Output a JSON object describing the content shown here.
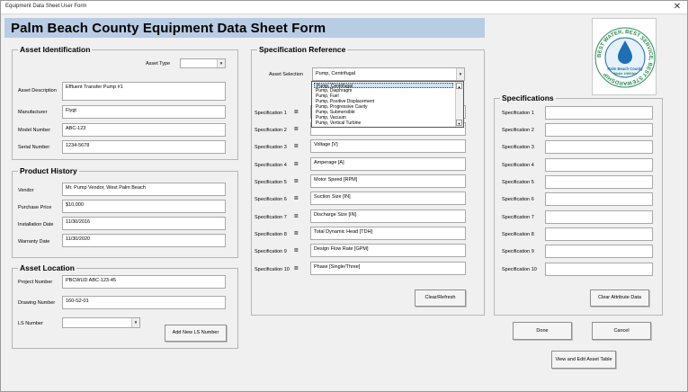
{
  "window": {
    "title": "Equipment Data Sheet User Form",
    "close_glyph": "✕"
  },
  "banner": {
    "title": "Palm Beach County Equipment Data Sheet Form"
  },
  "logo": {
    "ring_text": "BEST WATER, BEST SERVICE, BEST STEWARDSHIP",
    "inner_line1": "Palm Beach County",
    "inner_line2": "Water Utilities"
  },
  "asset_identification": {
    "legend": "Asset Identification",
    "asset_type_label": "Asset Type",
    "asset_type_value": "",
    "fields": [
      {
        "label": "Asset Description",
        "value": "Effluent Transfer Pump #1"
      },
      {
        "label": "Manufacturer",
        "value": "Flygt"
      },
      {
        "label": "Model Number",
        "value": "ABC-123"
      },
      {
        "label": "Serial Number",
        "value": "1234-5678"
      }
    ]
  },
  "product_history": {
    "legend": "Product History",
    "fields": [
      {
        "label": "Vendor",
        "value": "Mr. Pump Vendor, West Palm Beach"
      },
      {
        "label": "Purchase Price",
        "value": "$10,000"
      },
      {
        "label": "Installation Date",
        "value": "11/30/2016"
      },
      {
        "label": "Warranty Date",
        "value": "11/30/2020"
      }
    ]
  },
  "asset_location": {
    "legend": "Asset Location",
    "fields": [
      {
        "label": "Project Number",
        "value": "PBCWUD ABC-123-45"
      },
      {
        "label": "Drawing Number",
        "value": "160-S2-01"
      }
    ],
    "ls_label": "LS Number",
    "ls_value": "",
    "add_button": "Add New LS Number"
  },
  "spec_reference": {
    "legend": "Specification Reference",
    "asset_selection_label": "Asset Selection",
    "asset_selection_value": "Pump, Centrifugal",
    "dropdown_options": [
      "Pump, Centrifugal",
      "Pump, Diaphragm",
      "Pump, Fuel",
      "Pump, Positive Displacement",
      "Pump, Progressive Cavity",
      "Pump, Submersible",
      "Pump, Vacuum",
      "Pump, Vertical Turbine"
    ],
    "eq": "=",
    "rows": [
      {
        "label": "Specification 1",
        "value": ""
      },
      {
        "label": "Specification 2",
        "value": ""
      },
      {
        "label": "Specification 3",
        "value": "Voltage [V]"
      },
      {
        "label": "Specification 4",
        "value": "Amperage [A]"
      },
      {
        "label": "Specification 5",
        "value": "Motor Speed [RPM]"
      },
      {
        "label": "Specification 6",
        "value": "Suction Size [IN]"
      },
      {
        "label": "Specification 7",
        "value": "Discharge Size [IN]"
      },
      {
        "label": "Specification 8",
        "value": "Total Dynamic Head [TDH]"
      },
      {
        "label": "Specification 9",
        "value": "Design Flow Rate [GPM]"
      },
      {
        "label": "Specification 10",
        "value": "Phase [Single/Three]"
      }
    ],
    "clear_button": "Clear/Refresh"
  },
  "specifications": {
    "legend": "Specifications",
    "rows": [
      {
        "label": "Specification 1",
        "value": ""
      },
      {
        "label": "Specification 2",
        "value": ""
      },
      {
        "label": "Specification 3",
        "value": ""
      },
      {
        "label": "Specification 4",
        "value": ""
      },
      {
        "label": "Specification 5",
        "value": ""
      },
      {
        "label": "Specification 6",
        "value": ""
      },
      {
        "label": "Specification 7",
        "value": ""
      },
      {
        "label": "Specification 8",
        "value": ""
      },
      {
        "label": "Specification 9",
        "value": ""
      },
      {
        "label": "Specification 10",
        "value": ""
      }
    ],
    "clear_button": "Clear Attribute Data"
  },
  "footer": {
    "done": "Done",
    "cancel": "Cancel",
    "view_edit": "View and Edit Asset Table"
  },
  "icons": {
    "dropdown_arrow": "▼",
    "scroll_up": "▲",
    "scroll_down": "▼"
  },
  "colors": {
    "banner": "#b8cce4",
    "logo_blue": "#1f6fb5",
    "logo_green": "#2e8b57"
  }
}
